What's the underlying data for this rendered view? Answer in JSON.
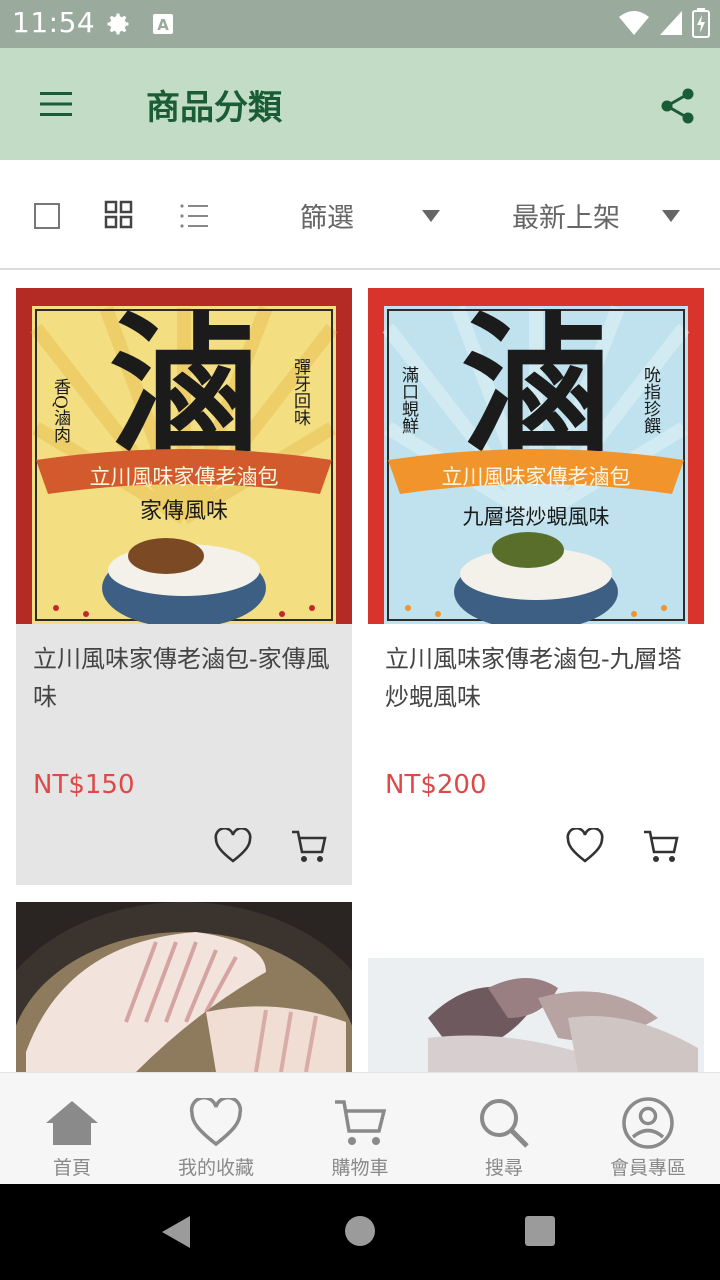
{
  "status_bar": {
    "time": "11:54"
  },
  "app_bar": {
    "title": "商品分類",
    "bg_color": "#c3dcc6",
    "title_color": "#1a5c35"
  },
  "toolbar": {
    "filter_label": "篩選",
    "sort_label": "最新上架"
  },
  "products": [
    {
      "title": "立川風味家傳老滷包-家傳風味",
      "price": "NT$150",
      "image": {
        "big_char": "滷",
        "banner_text": "立川風味家傳老滷包",
        "subtitle": "家傳風味",
        "left_vertical": "香Q滷肉",
        "right_vertical": "彈牙回味"
      }
    },
    {
      "title": "立川風味家傳老滷包-九層塔炒蜆風味",
      "price": "NT$200",
      "image": {
        "big_char": "滷",
        "banner_text": "立川風味家傳老滷包",
        "subtitle": "九層塔炒蜆風味",
        "left_vertical": "滿口蜆鮮",
        "right_vertical": "吮指珍饌"
      }
    }
  ],
  "bottom_nav": [
    {
      "label": "首頁",
      "icon": "home-icon"
    },
    {
      "label": "我的收藏",
      "icon": "heart-icon"
    },
    {
      "label": "購物車",
      "icon": "cart-icon"
    },
    {
      "label": "搜尋",
      "icon": "search-icon"
    },
    {
      "label": "會員專區",
      "icon": "account-icon"
    }
  ],
  "colors": {
    "price": "#e04848",
    "accent": "#1a5c35"
  }
}
